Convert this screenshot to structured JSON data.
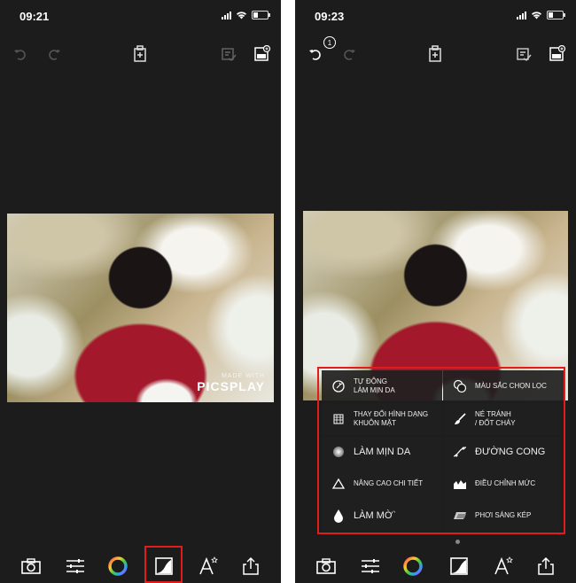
{
  "screens": [
    {
      "time": "09:21",
      "watermark": {
        "line1": "MADE WITH",
        "line2": "PICSPLAY"
      },
      "toolbar_icons": [
        "undo-icon",
        "redo-icon",
        "info-save-icon",
        "compare-icon",
        "save-photo-icon"
      ],
      "bottom_icons": [
        "camera-icon",
        "adjust-icon",
        "color-wheel-icon",
        "effects-icon",
        "text-icon",
        "share-icon"
      ],
      "selected_tool": "effects-icon"
    },
    {
      "time": "09:23",
      "undo_badge": "1",
      "menu": {
        "left": [
          {
            "label": "TỰ ĐỘNG\nLÀM MỊN DA",
            "icon": "auto-smooth-icon",
            "small": true
          },
          {
            "label": "THAY ĐỔI HÌNH DẠNG\nKHUÔN MẶT",
            "icon": "face-shape-icon",
            "small": true
          },
          {
            "label": "LÀM MỊN DA",
            "icon": "smooth-skin-icon",
            "small": false
          },
          {
            "label": "NÂNG CAO CHI TIẾT",
            "icon": "detail-icon",
            "small": true
          },
          {
            "label": "LÀM MỜ`",
            "icon": "blur-icon",
            "small": false
          }
        ],
        "right": [
          {
            "label": "MÀU SẮC CHỌN LỌC",
            "icon": "selective-color-icon",
            "small": true
          },
          {
            "label": "NÉ TRÁNH\n/ ĐỐT CHÁY",
            "icon": "dodge-burn-icon",
            "small": true
          },
          {
            "label": "ĐƯỜNG CONG",
            "icon": "curves-icon",
            "small": false
          },
          {
            "label": "ĐIỀU CHỈNH MỨC",
            "icon": "levels-icon",
            "small": true
          },
          {
            "label": "PHƠI SÁNG KÉP",
            "icon": "double-exposure-icon",
            "small": true
          }
        ]
      },
      "colors": {
        "highlight": "#e01c1c",
        "background": "#1c1c1c"
      }
    }
  ]
}
